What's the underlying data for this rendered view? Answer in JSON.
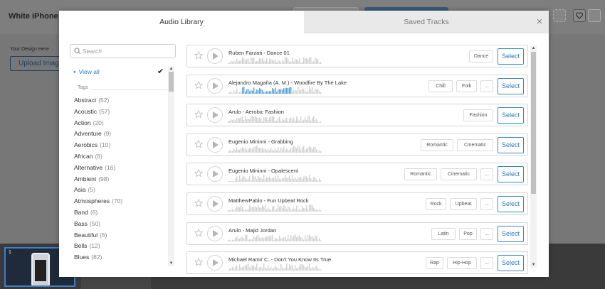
{
  "background": {
    "page_title": "White iPhone Vid",
    "design_label": "Your Design Here",
    "upload_button": "Upload Imag",
    "thumbnail_number": "1"
  },
  "modal": {
    "tabs": [
      {
        "label": "Audio Library",
        "active": true
      },
      {
        "label": "Saved Tracks",
        "active": false
      }
    ],
    "close_label": "×"
  },
  "filters": {
    "search_placeholder": "Search",
    "view_all": "View all",
    "view_all_checked": true,
    "tags_heading": "Tags",
    "tags": [
      {
        "name": "Abstract",
        "count": "(52)"
      },
      {
        "name": "Acoustic",
        "count": "(57)"
      },
      {
        "name": "Action",
        "count": "(20)"
      },
      {
        "name": "Adventure",
        "count": "(9)"
      },
      {
        "name": "Aerobics",
        "count": "(10)"
      },
      {
        "name": "African",
        "count": "(6)"
      },
      {
        "name": "Alternative",
        "count": "(16)"
      },
      {
        "name": "Ambient",
        "count": "(98)"
      },
      {
        "name": "Asia",
        "count": "(5)"
      },
      {
        "name": "Atmospheres",
        "count": "(70)"
      },
      {
        "name": "Band",
        "count": "(6)"
      },
      {
        "name": "Bass",
        "count": "(50)"
      },
      {
        "name": "Beautiful",
        "count": "(6)"
      },
      {
        "name": "Bells",
        "count": "(12)"
      },
      {
        "name": "Blues",
        "count": "(82)"
      }
    ]
  },
  "tracks": [
    {
      "title": "Ruben Farzati - Dance 01",
      "tags": [
        "Dance"
      ],
      "more": false,
      "progress": 0,
      "select": "Select"
    },
    {
      "title": "Alejandro Magaña (A. M.) - Woodfire By The Lake",
      "tags": [
        "Chill",
        "Folk"
      ],
      "more": true,
      "progress": 0.75,
      "select": "Select"
    },
    {
      "title": "Arulo - Aerobic Fashion",
      "tags": [
        "Fashion"
      ],
      "more": false,
      "progress": 0,
      "select": "Select"
    },
    {
      "title": "Eugenio Mininni - Grabbing",
      "tags": [
        "Romantic",
        "Cinematic"
      ],
      "more": false,
      "progress": 0,
      "select": "Select"
    },
    {
      "title": "Eugenio Mininni - Opalescent",
      "tags": [
        "Romantic",
        "Cinematic"
      ],
      "more": true,
      "progress": 0,
      "select": "Select"
    },
    {
      "title": "MatthewPablo - Fun Upbeat Rock",
      "tags": [
        "Rock",
        "Upbeat"
      ],
      "more": true,
      "progress": 0,
      "select": "Select"
    },
    {
      "title": "Arulo - Majid Jordan",
      "tags": [
        "Latin",
        "Pop"
      ],
      "more": true,
      "progress": 0,
      "select": "Select"
    },
    {
      "title": "Michael Ramir C. - Don't You Know Its True",
      "tags": [
        "Rap",
        "Hip-Hop"
      ],
      "more": true,
      "progress": 0,
      "select": "Select"
    }
  ],
  "more_label": "...",
  "colors": {
    "accent": "#2f79bb",
    "waveform": "#d2d2d2",
    "waveform_played": "#5aa3d6"
  }
}
